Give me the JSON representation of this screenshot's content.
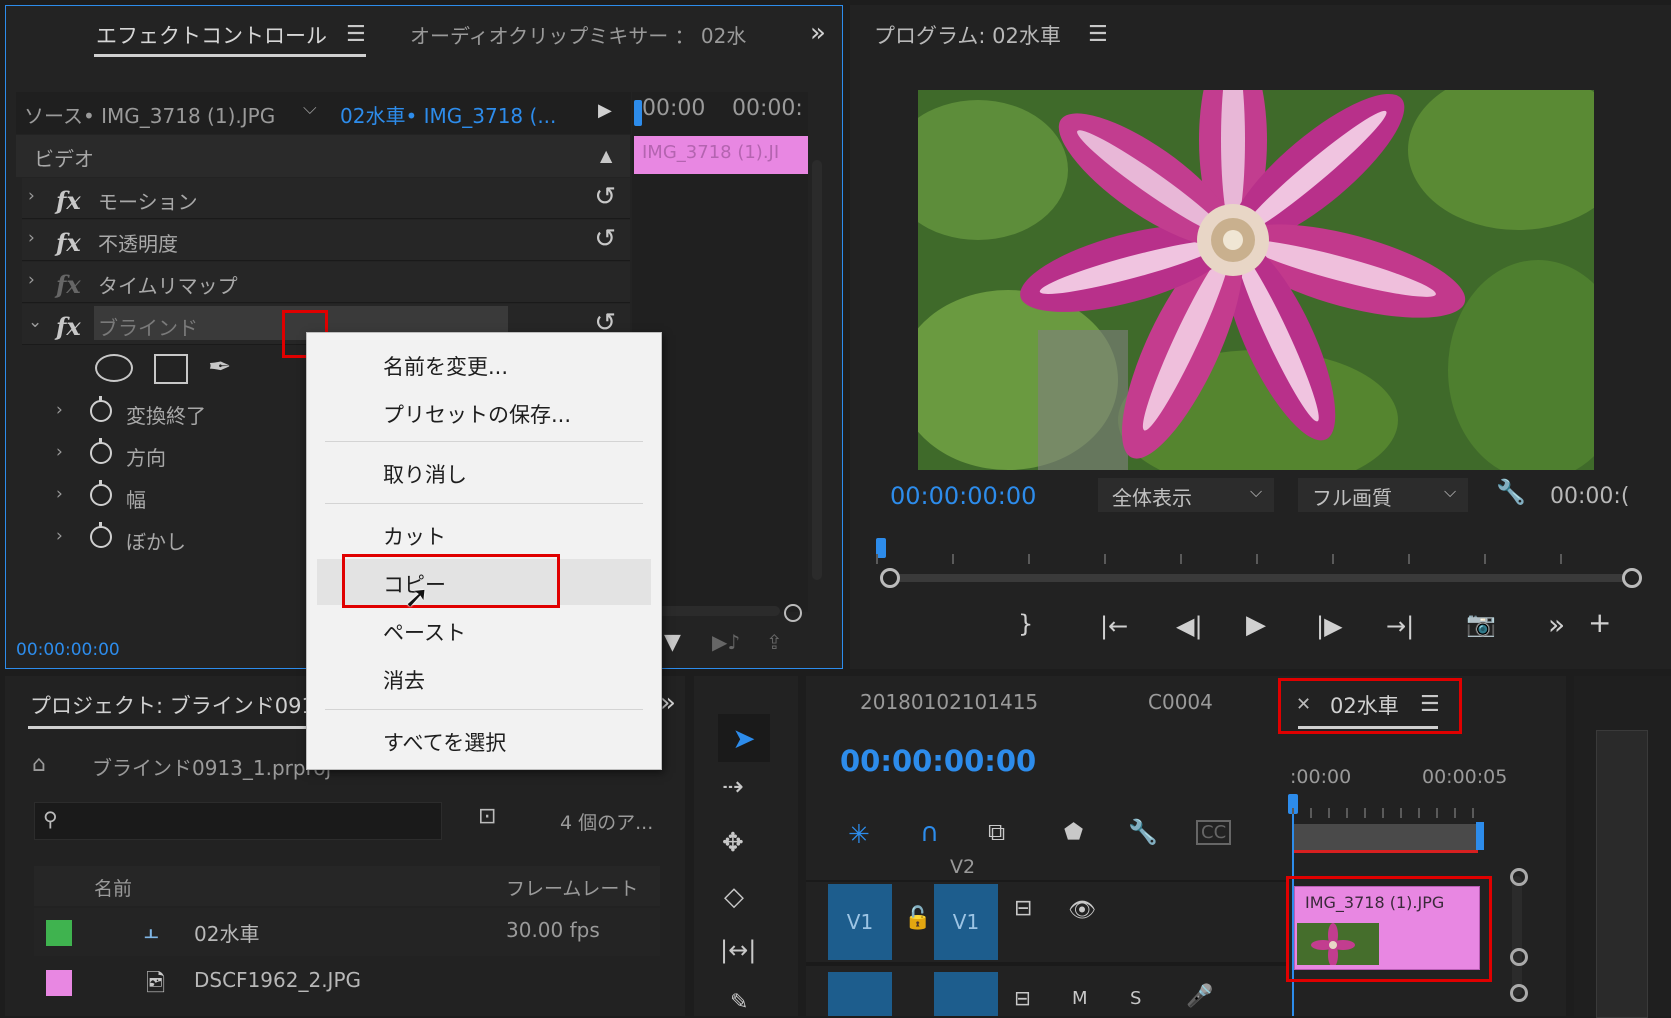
{
  "effect_controls": {
    "tab_effect_controls": "エフェクトコントロール",
    "tab_audio_mixer": "オーディオクリップミキサー ： 02水",
    "source_label": "ソース• IMG_3718 (1).JPG",
    "sequence_clip_label": "02水車• IMG_3718 (...",
    "time_ruler": [
      "00:00",
      "00:00:"
    ],
    "clip_bar_label": "IMG_3718 (1).JI",
    "video_header": "ビデオ",
    "fx_rows": [
      {
        "label": "モーション"
      },
      {
        "label": "不透明度"
      },
      {
        "label": "タイムリマップ"
      },
      {
        "label": "ブラインド"
      }
    ],
    "props": [
      "変換終了",
      "方向",
      "幅",
      "ぼかし"
    ],
    "timecode": "00:00:00:00"
  },
  "context_menu": {
    "items": [
      "名前を変更...",
      "プリセットの保存...",
      "取り消し",
      "カット",
      "コピー",
      "ペースト",
      "消去",
      "すべてを選択"
    ]
  },
  "program_monitor": {
    "title": "プログラム: 02水車",
    "timecode": "00:00:00:00",
    "zoom_select": "全体表示",
    "quality_select": "フル画質",
    "duration": "00:00:("
  },
  "project": {
    "title": "プロジェクト: ブラインド091",
    "file_name": "ブラインド0913_1.prproj",
    "item_count": "4 個のア...",
    "columns": {
      "name": "名前",
      "fps": "フレームレート"
    },
    "items": [
      {
        "name": "02水車",
        "fps": "30.00 fps",
        "color": "#3fb34f"
      },
      {
        "name": "DSCF1962_2.JPG",
        "fps": "",
        "color": "#e887e2"
      }
    ]
  },
  "timeline": {
    "tabs": [
      "20180102101415",
      "C0004",
      "02水車"
    ],
    "timecode": "00:00:00:00",
    "ruler": [
      ":00:00",
      "00:00:05"
    ],
    "track_v2": "V2",
    "track_v1": "V1",
    "track_v1_target": "V1",
    "audio_m": "M",
    "audio_s": "S",
    "clip_label": "IMG_3718 (1).JPG"
  },
  "colors": {
    "accent_blue": "#2d8ceb",
    "clip_pink": "#e887e2",
    "highlight_red": "#e00000"
  }
}
